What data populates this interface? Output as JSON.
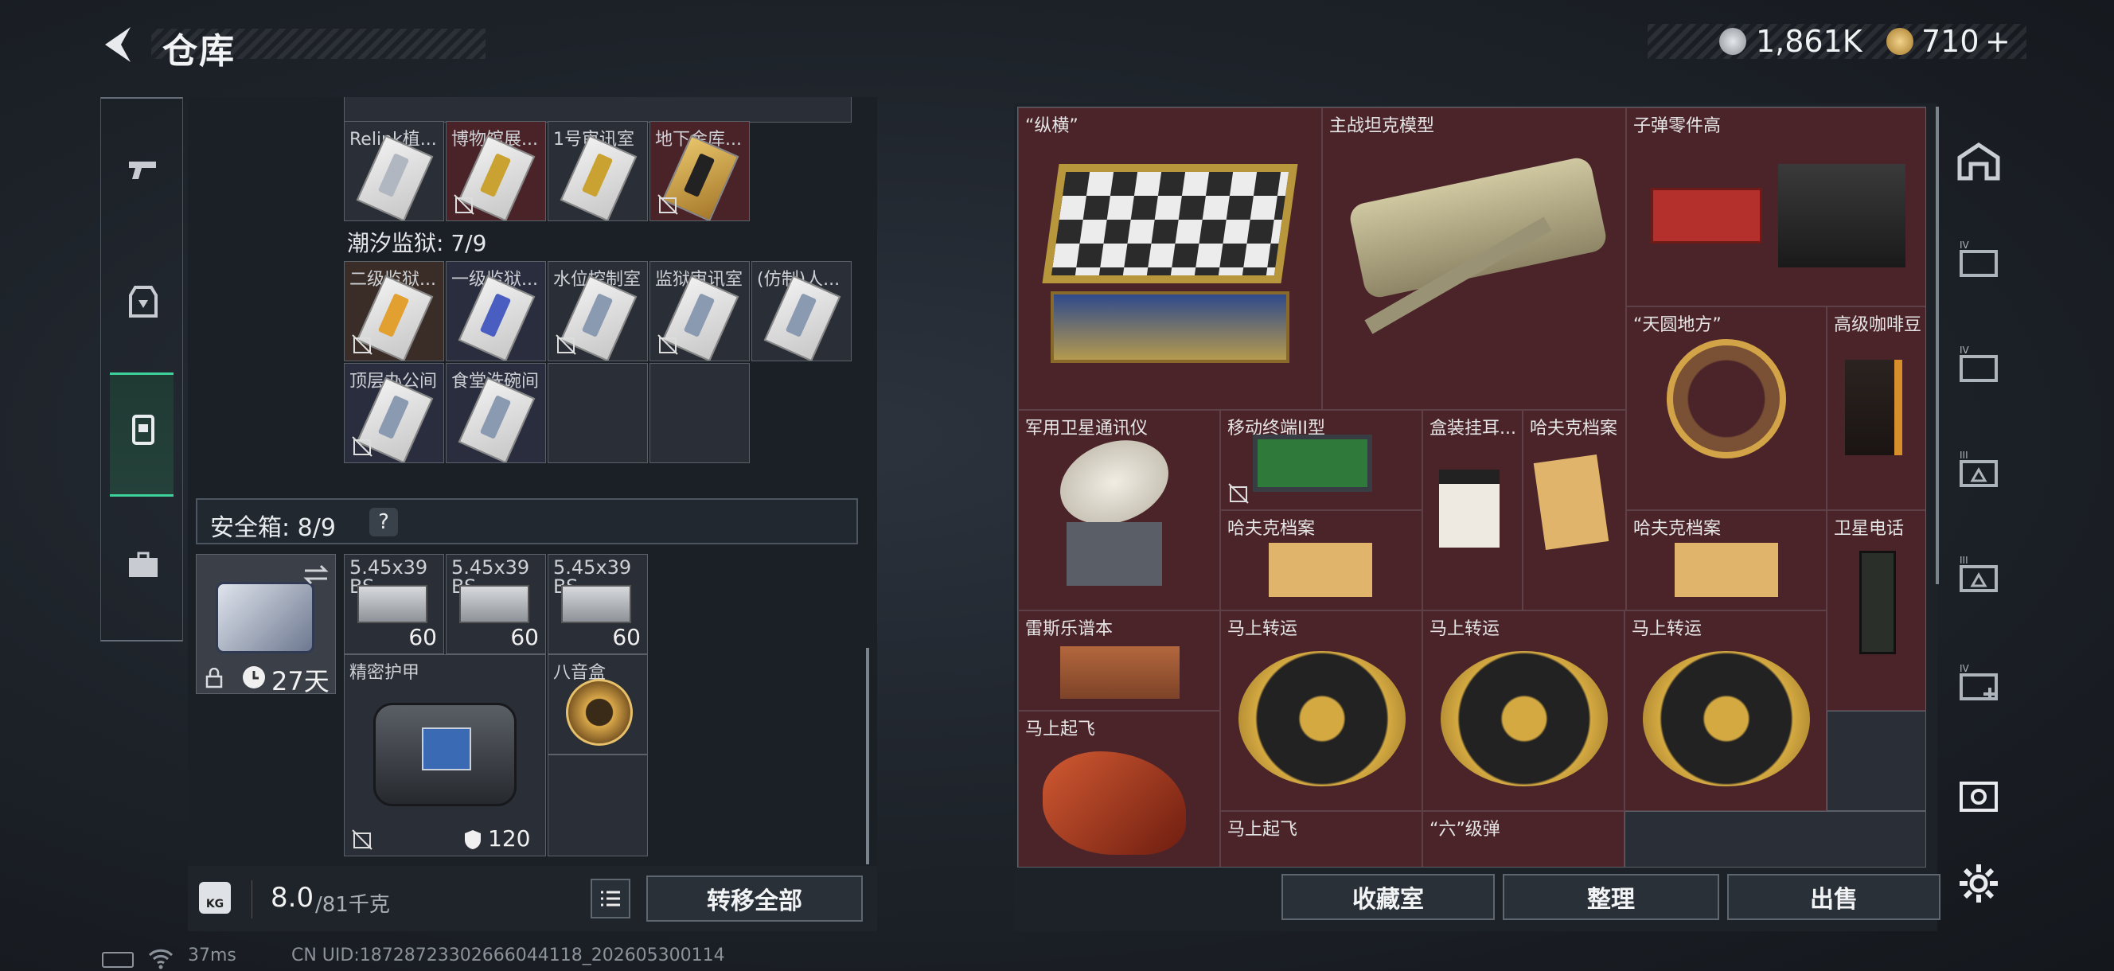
{
  "header": {
    "title": "仓库"
  },
  "currency": {
    "silver": "1,861K",
    "gold": "710",
    "plus": "+"
  },
  "left_nav": {
    "items": [
      "weapon",
      "armor",
      "backpack",
      "toolbox"
    ]
  },
  "left_panel": {
    "top_row_labels": [
      "Relink植...",
      "博物馆展...",
      "1号审讯室",
      "地下金库..."
    ],
    "section_prison": {
      "title": "潮汐监狱: 7/9"
    },
    "prison_labels": [
      "二级监狱...",
      "一级监狱...",
      "水位控制室",
      "监狱审讯室",
      "(仿制)人...",
      "顶层办公间",
      "食堂洗碗间"
    ],
    "safebox": {
      "title": "安全箱: 8/9",
      "help": "?",
      "timer": "27天"
    },
    "ammo_labels": [
      "5.45x39 BS",
      "5.45x39 BS",
      "5.45x39 BS"
    ],
    "ammo_qty": [
      "60",
      "60",
      "60"
    ],
    "armor_label": "精密护甲",
    "armor_value": "120",
    "music_box_label": "八音盒"
  },
  "weight": {
    "value": "8.0",
    "max": "/81千克"
  },
  "transfer_all": "转移全部",
  "right_panel": {
    "labels": {
      "chess": "“纵横”",
      "tank": "主战坦克模型",
      "bullet": "子弹零件高",
      "armillary": "“天圆地方”",
      "coffee": "高级咖啡豆",
      "satellite": "军用卫星通讯仪",
      "mobile": "移动终端II型",
      "box": "盒装挂耳...",
      "hafuk1": "哈夫克档案",
      "hafuk2": "哈夫克档案",
      "hafuk3": "哈夫克档案",
      "satphone": "卫星电话",
      "leisile": "雷斯乐谱本",
      "horse1": "马上转运",
      "horse2": "马上转运",
      "horse3": "马上转运",
      "flyhorse": "马上起飞",
      "flyhorse2": "马上起飞",
      "six": "“六”级弹"
    },
    "buttons": {
      "collection": "收藏室",
      "organize": "整理",
      "sell": "出售"
    }
  },
  "status_bar": {
    "ping": "37ms",
    "uid": "CN UID:18728723302666044118_202605300114"
  }
}
